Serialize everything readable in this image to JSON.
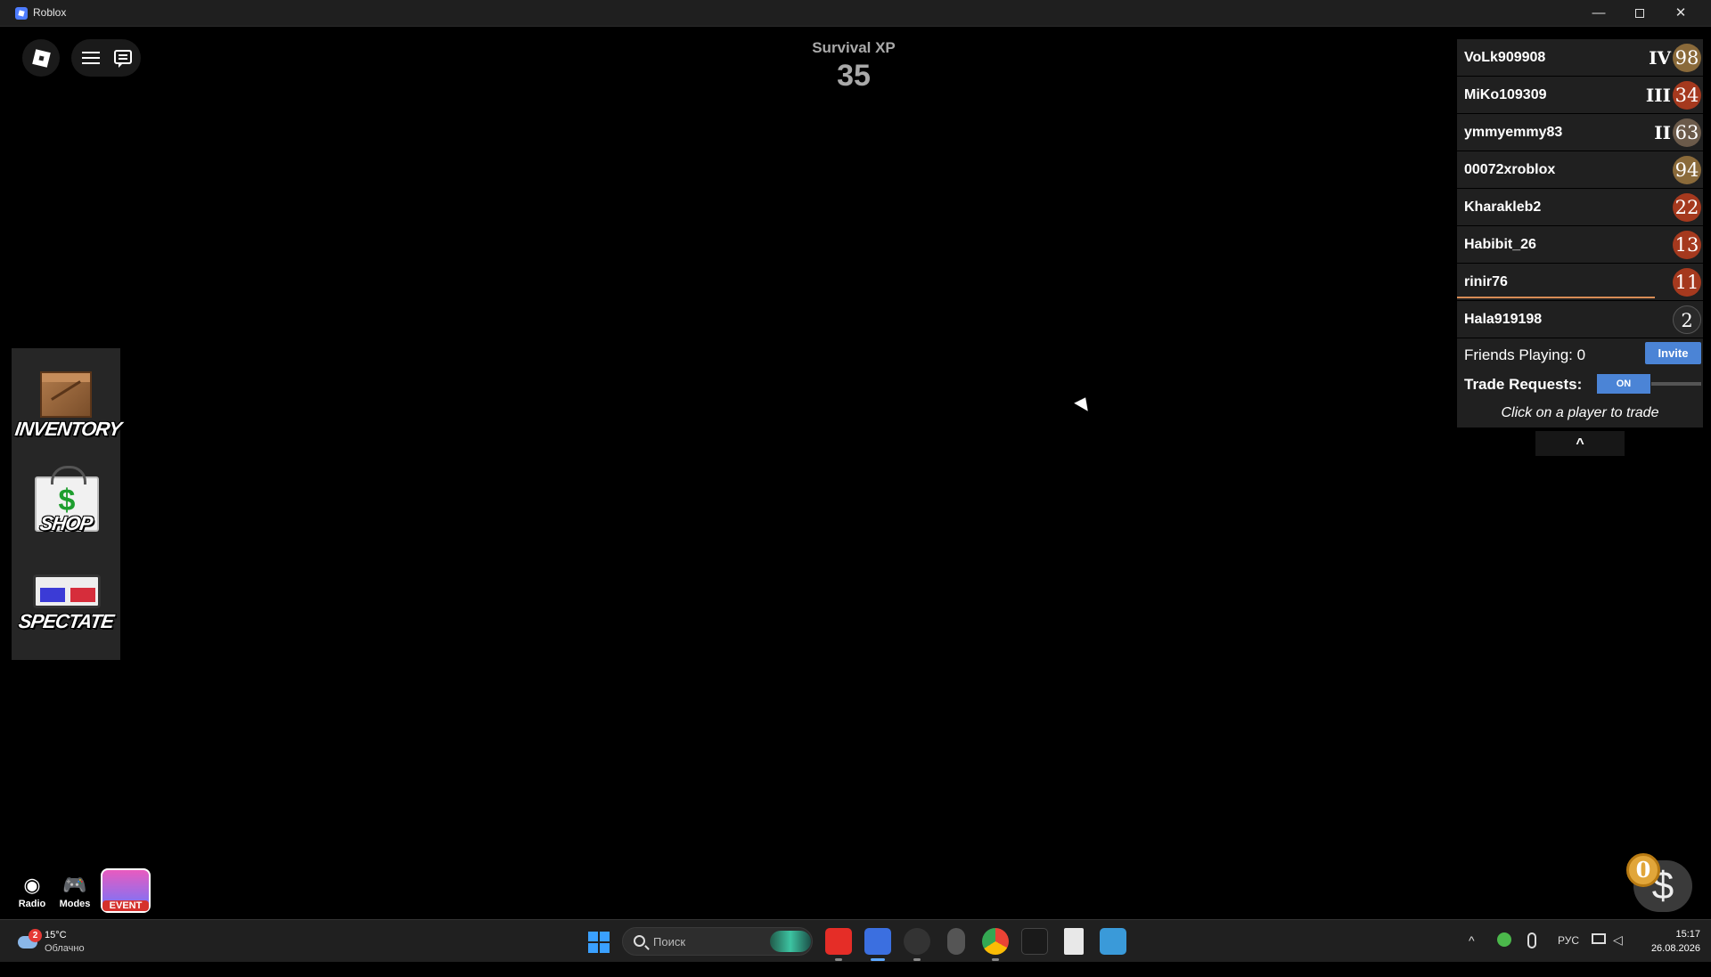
{
  "window": {
    "title": "Roblox",
    "minimize_glyph": "—",
    "close_glyph": "✕"
  },
  "hud": {
    "xp_label": "Survival XP",
    "xp_value": "35"
  },
  "side_menu": {
    "inventory": "INVENTORY",
    "shop": "SHOP",
    "shop_symbol": "$",
    "spectate": "SPECTATE"
  },
  "leaderboard": {
    "players": [
      {
        "name": "VoLk909908",
        "rank": "IV",
        "level": "98",
        "badge_color": "#8a6a3a"
      },
      {
        "name": "MiKo109309",
        "rank": "III",
        "level": "34",
        "badge_color": "#a5391e"
      },
      {
        "name": "ymmyemmy83",
        "rank": "II",
        "level": "63",
        "badge_color": "#6b5a4a"
      },
      {
        "name": "00072xroblox",
        "rank": "",
        "level": "94",
        "badge_color": "#8a6a3a"
      },
      {
        "name": "Kharakleb2",
        "rank": "",
        "level": "22",
        "badge_color": "#a5391e"
      },
      {
        "name": "Habibit_26",
        "rank": "",
        "level": "13",
        "badge_color": "#a5391e"
      },
      {
        "name": "rinir76",
        "rank": "",
        "level": "11",
        "badge_color": "#a5391e"
      },
      {
        "name": "Hala919198",
        "rank": "",
        "level": "2",
        "badge_color": "#2a2a2a"
      }
    ],
    "friends_playing": "Friends Playing: 0",
    "invite_label": "Invite",
    "trade_requests_label": "Trade Requests:",
    "trade_toggle": "ON",
    "hint": "Click on a player to trade",
    "collapse_glyph": "^"
  },
  "bottom_bar": {
    "radio": "Radio",
    "modes": "Modes",
    "event": "EVENT"
  },
  "currency": {
    "coins": "0",
    "bag_symbol": "$"
  },
  "taskbar": {
    "weather_badge": "2",
    "temperature": "15°C",
    "weather_desc": "Облачно",
    "search_placeholder": "Поиск",
    "language": "РУС",
    "time": "15:17",
    "date": "26.08.2026",
    "tray_chevron": "^"
  },
  "colors": {
    "accent_blue": "#4b84d6",
    "taskbar_bg": "#202020",
    "leaderboard_bg": "#232323"
  }
}
